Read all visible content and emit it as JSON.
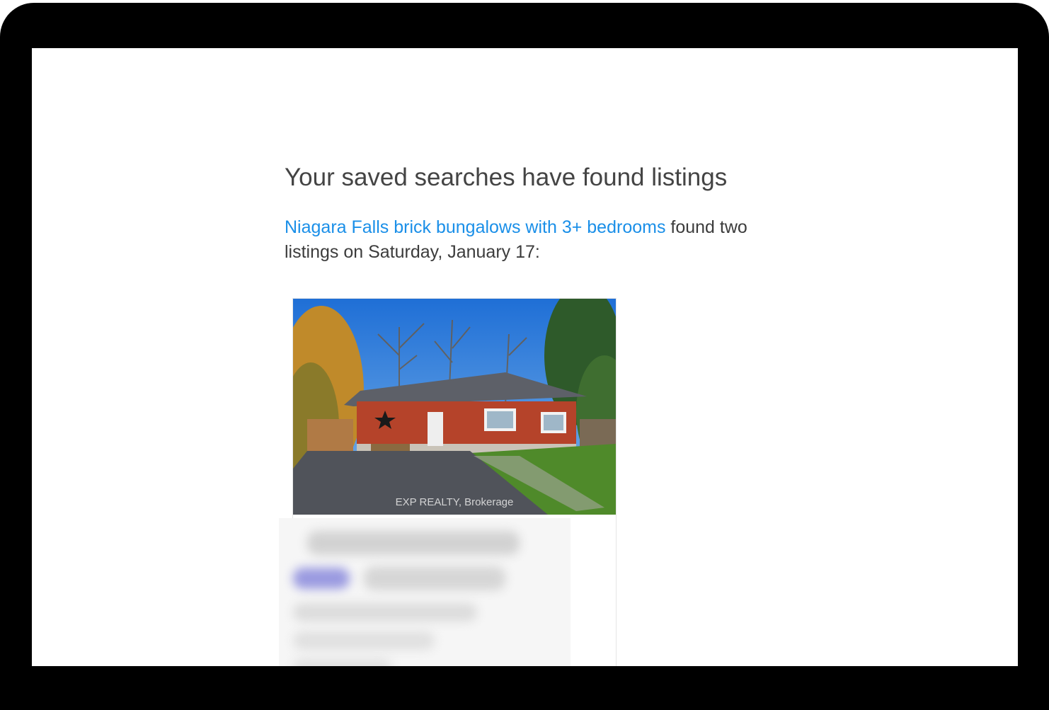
{
  "email": {
    "heading": "Your saved searches have found listings",
    "search_link": "Niagara Falls brick bungalows with 3+ bedrooms",
    "intro_suffix": " found two listings on Saturday, January 17:"
  },
  "listing": {
    "photo_watermark": "EXP REALTY, Brokerage"
  },
  "colors": {
    "link": "#1a8fe8",
    "heading": "#444444",
    "device_frame": "#000000"
  }
}
